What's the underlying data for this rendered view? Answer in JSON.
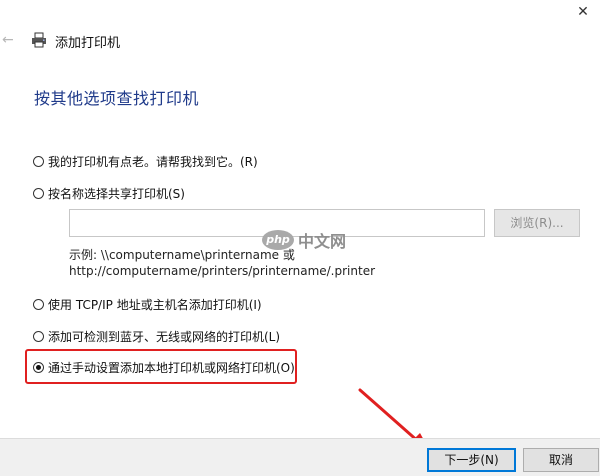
{
  "window": {
    "title": "添加打印机",
    "close_glyph": "✕",
    "back_glyph": "←"
  },
  "page": {
    "heading": "按其他选项查找打印机"
  },
  "options": [
    {
      "label": "我的打印机有点老。请帮我找到它。(R)",
      "checked": false
    },
    {
      "label": "按名称选择共享打印机(S)",
      "checked": false
    },
    {
      "label": "使用 TCP/IP 地址或主机名添加打印机(I)",
      "checked": false
    },
    {
      "label": "添加可检测到蓝牙、无线或网络的打印机(L)",
      "checked": false
    },
    {
      "label": "通过手动设置添加本地打印机或网络打印机(O)",
      "checked": true
    }
  ],
  "share": {
    "input_value": "",
    "browse_label": "浏览(R)...",
    "example_line1": "示例: \\\\computername\\printername 或",
    "example_line2": "http://computername/printers/printername/.printer"
  },
  "watermark": {
    "logo_text": "php",
    "text": "中文网"
  },
  "buttons": {
    "next_label": "下一步(N)",
    "cancel_label": "取消"
  },
  "colors": {
    "heading": "#1f3a8a",
    "highlight": "#e02020",
    "primary_border": "#0078d7"
  }
}
